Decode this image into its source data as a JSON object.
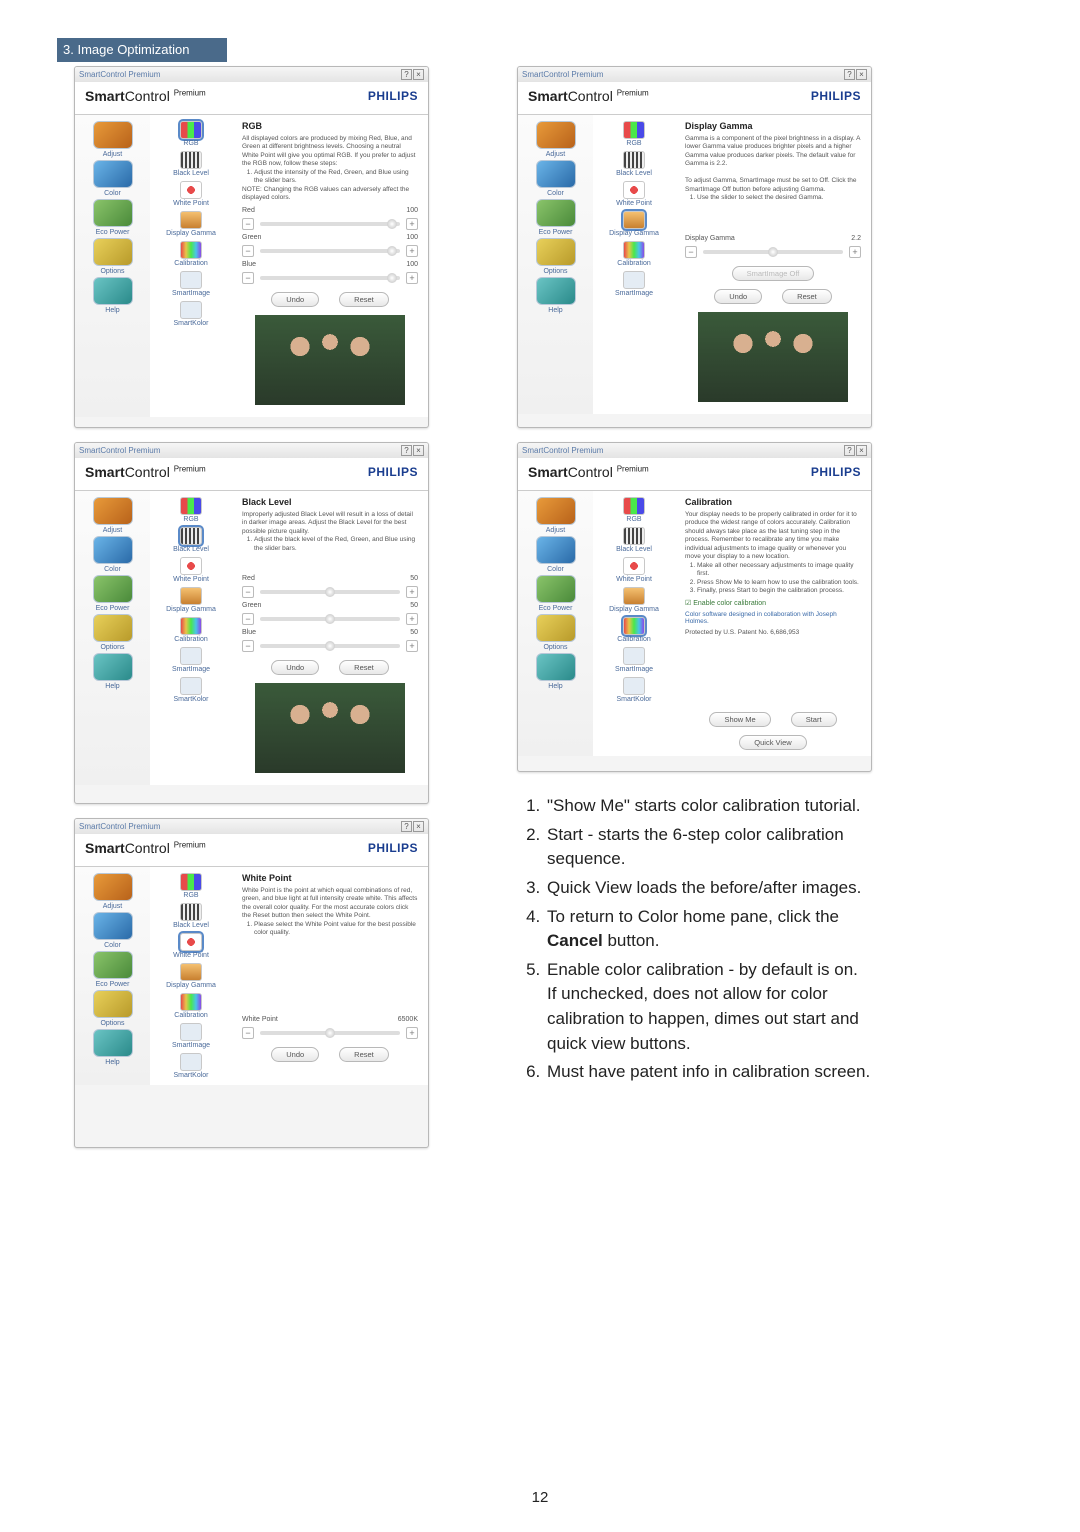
{
  "header": "3. Image Optimization",
  "page_number": "12",
  "win": {
    "title": "SmartControl Premium",
    "brand_bold": "Smart",
    "brand_rest": "Control ",
    "brand_prem": "Premium",
    "philips": "PHILIPS",
    "help_q": "?",
    "close_x": "×"
  },
  "nav": {
    "adjust": "Adjust",
    "color": "Color",
    "eco": "Eco Power",
    "options": "Options",
    "help": "Help"
  },
  "sub": {
    "rgb": "RGB",
    "bl": "Black Level",
    "wp": "White Point",
    "dg": "Display Gamma",
    "cal": "Calibration",
    "si": "SmartImage",
    "sk": "SmartKolor"
  },
  "rgb": {
    "title": "RGB",
    "p1": "All displayed colors are produced by mixing Red, Blue, and Green at different brightness levels. Choosing a neutral White Point will give you optimal RGB. If you prefer to adjust the RGB now, follow these steps:",
    "li1": "Adjust the intensity of the Red, Green, and Blue using the slider bars.",
    "note": "NOTE: Changing the RGB values can adversely affect the displayed colors.",
    "red": "Red",
    "green": "Green",
    "blue": "Blue",
    "v100": "100",
    "undo": "Undo",
    "reset": "Reset"
  },
  "bl": {
    "title": "Black Level",
    "p1": "Improperly adjusted Black Level will result in a loss of detail in darker image areas. Adjust the Black Level for the best possible picture quality.",
    "li1": "Adjust the black level of the Red, Green, and Blue using the slider bars.",
    "v50": "50"
  },
  "wp": {
    "title": "White Point",
    "p1": "White Point is the point at which equal combinations of red, green, and blue light at full intensity create white. This affects the overall color quality. For the most accurate colors click the Reset button then select the White Point.",
    "li1": "Please select the White Point value for the best possible color quality.",
    "label": "White Point",
    "val": "6500K"
  },
  "dg": {
    "title": "Display Gamma",
    "p1": "Gamma is a component of the pixel brightness in a display. A lower Gamma value produces brighter pixels and a higher Gamma value produces darker pixels. The default value for Gamma is 2.2.",
    "p2": "To adjust Gamma, SmartImage must be set to Off. Click the SmartImage Off button before adjusting Gamma.",
    "li1": "Use the slider to select the desired Gamma.",
    "label": "Display Gamma",
    "val": "2.2",
    "sioff": "SmartImage Off"
  },
  "cal": {
    "title": "Calibration",
    "p1": "Your display needs to be properly calibrated in order for it to produce the widest range of colors accurately. Calibration should always take place as the last tuning step in the process. Remember to recalibrate any time you make individual adjustments to image quality or whenever you move your display to a new location.",
    "li1": "Make all other necessary adjustments to image quality first.",
    "li2": "Press Show Me to learn how to use the calibration tools.",
    "li3": "Finally, press Start to begin the calibration process.",
    "chk": "Enable color calibration",
    "cred": "Color software designed in collaboration with Joseph Holmes.",
    "patent": "Protected by U.S. Patent No. 6,686,953",
    "showme": "Show Me",
    "start": "Start",
    "quickview": "Quick View"
  },
  "instructions": {
    "i1": "\"Show Me\" starts color calibration tutorial.",
    "i2": "Start - starts the 6-step color calibration sequence.",
    "i3": "Quick View loads the before/after images.",
    "i4a": "To return to Color home pane, click the ",
    "i4b": "Cancel",
    "i4c": " button.",
    "i5": "Enable color calibration - by default is on. If unchecked, does not allow for color calibration to happen, dimes out start and quick view buttons.",
    "i6": "Must have patent info in calibration screen."
  }
}
